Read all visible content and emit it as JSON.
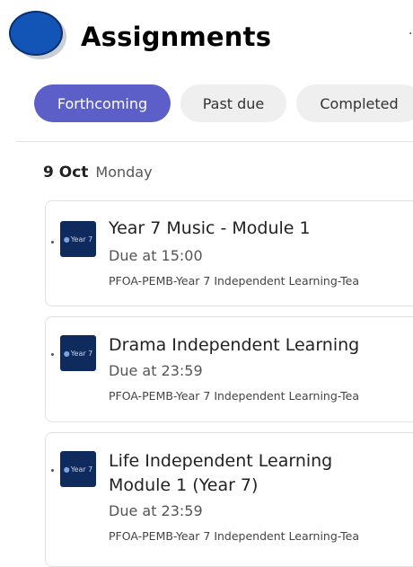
{
  "header": {
    "title": "Assignments",
    "corner_mark": "·"
  },
  "tabs": [
    {
      "label": "Forthcoming",
      "active": true
    },
    {
      "label": "Past due",
      "active": false
    },
    {
      "label": "Completed",
      "active": false
    }
  ],
  "date_group": {
    "date": "9 Oct",
    "weekday": "Monday"
  },
  "assignments": [
    {
      "logo_text": "Year 7",
      "title_lines": [
        "Year 7 Music - Module 1"
      ],
      "due": "Due at 15:00",
      "team": "PFOA-PEMB-Year 7 Independent Learning-Tea"
    },
    {
      "logo_text": "Year 7",
      "title_lines": [
        "Drama Independent Learning"
      ],
      "due": "Due at 23:59",
      "team": "PFOA-PEMB-Year 7 Independent Learning-Tea"
    },
    {
      "logo_text": "Year 7",
      "title_lines": [
        "Life Independent Learning",
        "Module 1 (Year 7)"
      ],
      "due": "Due at 23:59",
      "team": "PFOA-PEMB-Year 7 Independent Learning-Tea"
    }
  ],
  "colors": {
    "accent": "#5b5fc7",
    "avatar": "#1355b6",
    "logo_bg": "#0f2a5c"
  },
  "icons": {
    "avatar": "user-avatar-icon",
    "team_logo": "year7-shield-icon"
  }
}
